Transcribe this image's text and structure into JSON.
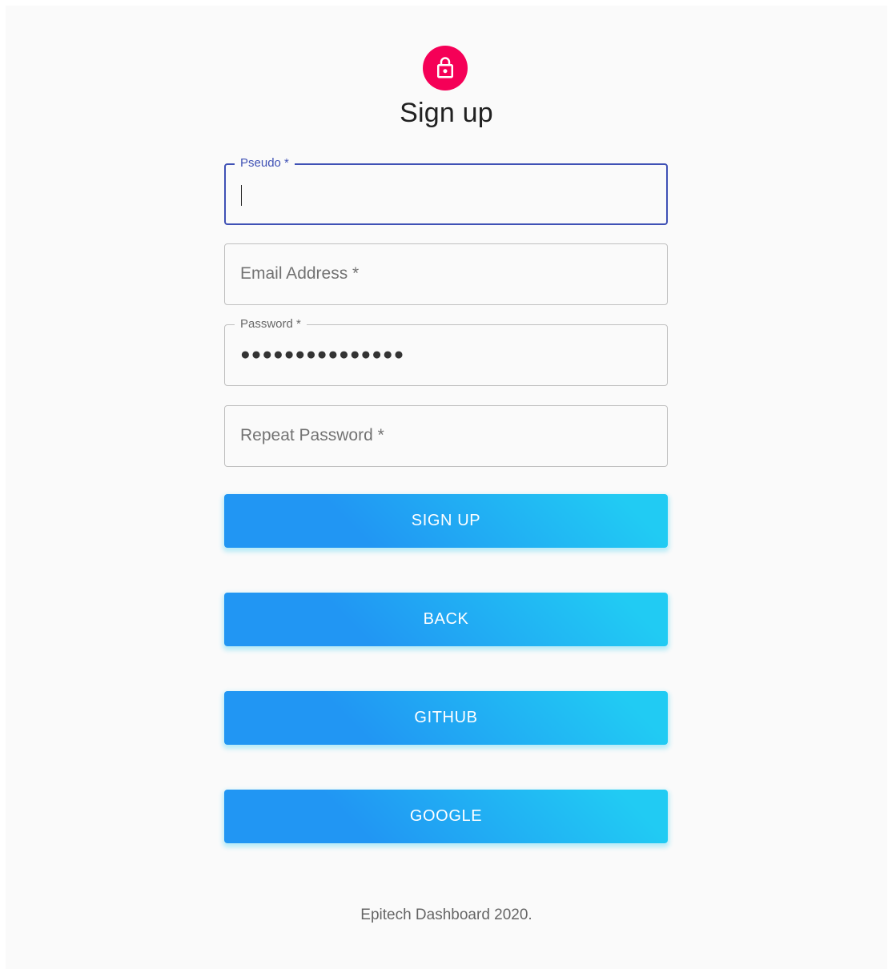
{
  "colors": {
    "avatar_bg": "#f50057",
    "focus": "#3f51b5",
    "button_gradient_start": "#2196f3",
    "button_gradient_end": "#21cbf3"
  },
  "header": {
    "icon": "lock-icon",
    "title": "Sign up"
  },
  "form": {
    "pseudo": {
      "label": "Pseudo *",
      "value": ""
    },
    "email": {
      "label": "Email Address *",
      "value": ""
    },
    "password": {
      "label": "Password *",
      "value": "●●●●●●●●●●●●●●●"
    },
    "repeat_password": {
      "label": "Repeat Password *",
      "value": ""
    }
  },
  "buttons": {
    "sign_up": "SIGN UP",
    "back": "BACK",
    "github": "GITHUB",
    "google": "GOOGLE"
  },
  "footer": {
    "text": "Epitech Dashboard 2020."
  }
}
